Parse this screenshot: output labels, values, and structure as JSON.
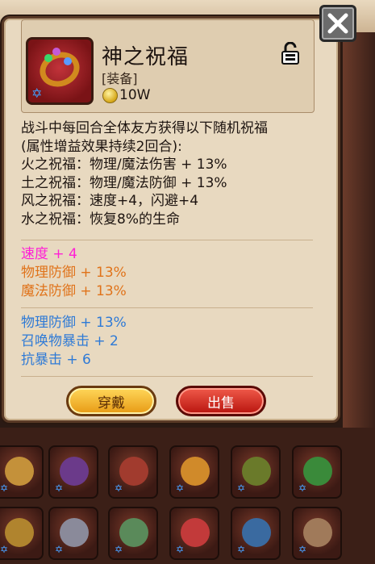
{
  "item": {
    "name": "神之祝福",
    "type": "[装备]",
    "price": "10W",
    "icon": "ring-icon"
  },
  "description": [
    "战斗中每回合全体友方获得以下随机祝福",
    "(属性增益效果持续2回合):",
    "火之祝福：物理/魔法伤害 + 13%",
    "土之祝福：物理/魔法防御 + 13%",
    "风之祝福：速度+4，闪避+4",
    "水之祝福：恢复8%的生命"
  ],
  "stats_group1": [
    {
      "text": "速度 + 4",
      "color": "#ff1fd6"
    },
    {
      "text": "物理防御 + 13%",
      "color": "#e0731a"
    },
    {
      "text": "魔法防御 + 13%",
      "color": "#e0731a"
    }
  ],
  "stats_group2": [
    {
      "text": "物理防御 + 13%",
      "color": "#2e7ad6"
    },
    {
      "text": "召唤物暴击 + 2",
      "color": "#2e7ad6"
    },
    {
      "text": "抗暴击 + 6",
      "color": "#2e7ad6"
    }
  ],
  "buttons": {
    "equip": "穿戴",
    "sell": "出售"
  },
  "colors": {
    "panel": "#e8d9c0",
    "equip_button": "#f2b62a",
    "sell_button": "#d8281c"
  }
}
